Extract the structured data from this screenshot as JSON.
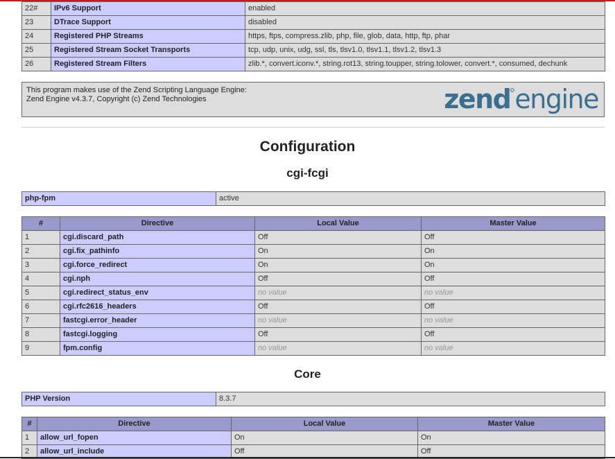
{
  "top_table": {
    "rows": [
      {
        "n": "22#",
        "key": "IPv6 Support",
        "value": "enabled"
      },
      {
        "n": "23",
        "key": "DTrace Support",
        "value": "disabled"
      },
      {
        "n": "24",
        "key": "Registered PHP Streams",
        "value": "https, ftps, compress.zlib, php, file, glob, data, http, ftp, phar"
      },
      {
        "n": "25",
        "key": "Registered Stream Socket Transports",
        "value": "tcp, udp, unix, udg, ssl, tls, tlsv1.0, tlsv1.1, tlsv1.2, tlsv1.3"
      },
      {
        "n": "26",
        "key": "Registered Stream Filters",
        "value": "zlib.*, convert.iconv.*, string.rot13, string.toupper, string.tolower, convert.*, consumed, dechunk"
      }
    ]
  },
  "zend": {
    "line1": "This program makes use of the Zend Scripting Language Engine:",
    "line2": "Zend Engine v4.3.7, Copyright (c) Zend Technologies",
    "logo_word1": "zend",
    "logo_word2": "engine",
    "logo_color": "#3a6f8f"
  },
  "configuration_title": "Configuration",
  "cgi": {
    "title": "cgi-fcgi",
    "info": {
      "key": "php-fpm",
      "value": "active"
    },
    "headers": {
      "n": "#",
      "directive": "Directive",
      "local": "Local Value",
      "master": "Master Value"
    },
    "rows": [
      {
        "n": "1",
        "name": "cgi.discard_path",
        "local": "Off",
        "master": "Off"
      },
      {
        "n": "2",
        "name": "cgi.fix_pathinfo",
        "local": "On",
        "master": "On"
      },
      {
        "n": "3",
        "name": "cgi.force_redirect",
        "local": "On",
        "master": "On"
      },
      {
        "n": "4",
        "name": "cgi.nph",
        "local": "Off",
        "master": "Off"
      },
      {
        "n": "5",
        "name": "cgi.redirect_status_env",
        "local": "no value",
        "master": "no value"
      },
      {
        "n": "6",
        "name": "cgi.rfc2616_headers",
        "local": "Off",
        "master": "Off"
      },
      {
        "n": "7",
        "name": "fastcgi.error_header",
        "local": "no value",
        "master": "no value"
      },
      {
        "n": "8",
        "name": "fastcgi.logging",
        "local": "Off",
        "master": "Off"
      },
      {
        "n": "9",
        "name": "fpm.config",
        "local": "no value",
        "master": "no value"
      }
    ]
  },
  "core": {
    "title": "Core",
    "info": {
      "key": "PHP Version",
      "value": "8.3.7"
    },
    "headers": {
      "n": "#",
      "directive": "Directive",
      "local": "Local Value",
      "master": "Master Value"
    },
    "rows": [
      {
        "n": "1",
        "name": "allow_url_fopen",
        "local": "On",
        "master": "On"
      },
      {
        "n": "2",
        "name": "allow_url_include",
        "local": "Off",
        "master": "Off"
      }
    ]
  },
  "colors": {
    "header_bg": "#9999cc",
    "key_bg": "#ccccff",
    "value_bg": "#dddddd",
    "top_accent": "#c41c1c"
  }
}
